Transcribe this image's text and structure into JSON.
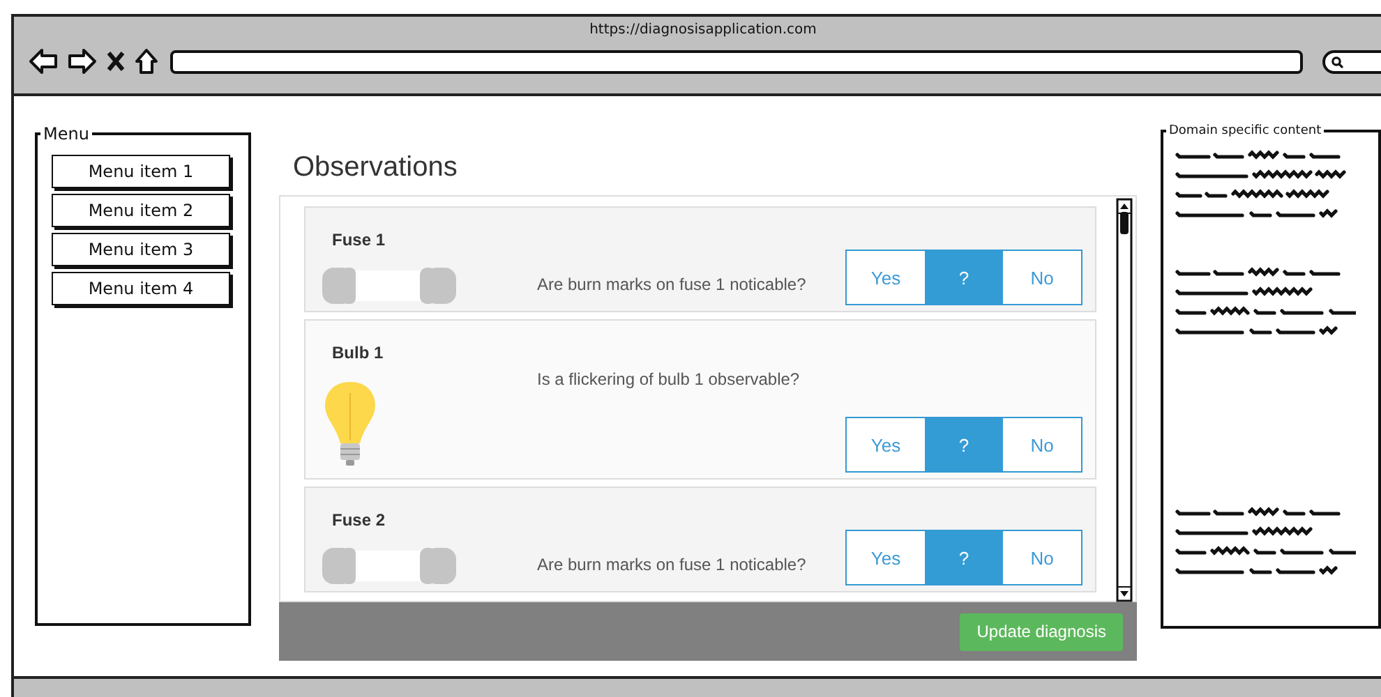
{
  "browser": {
    "url": "https://diagnosisapplication.com"
  },
  "menu": {
    "title": "Menu",
    "items": [
      "Menu item 1",
      "Menu item 2",
      "Menu item 3",
      "Menu item 4"
    ]
  },
  "main": {
    "title": "Observations",
    "observations": [
      {
        "kind": "fuse",
        "name": "Fuse 1",
        "question": "Are burn marks on fuse 1 noticable?",
        "answers": [
          {
            "label": "Yes",
            "selected": false
          },
          {
            "label": "?",
            "selected": true
          },
          {
            "label": "No",
            "selected": false
          }
        ]
      },
      {
        "kind": "bulb",
        "name": "Bulb 1",
        "question": "Is a flickering of bulb 1 observable?",
        "answers": [
          {
            "label": "Yes",
            "selected": false
          },
          {
            "label": "?",
            "selected": true
          },
          {
            "label": "No",
            "selected": false
          }
        ]
      },
      {
        "kind": "fuse",
        "name": "Fuse 2",
        "question": "Are burn marks on fuse 1 noticable?",
        "answers": [
          {
            "label": "Yes",
            "selected": false
          },
          {
            "label": "?",
            "selected": true
          },
          {
            "label": "No",
            "selected": false
          }
        ]
      }
    ],
    "action": "Update diagnosis"
  },
  "side_panel": {
    "title": "Domain specific content"
  }
}
